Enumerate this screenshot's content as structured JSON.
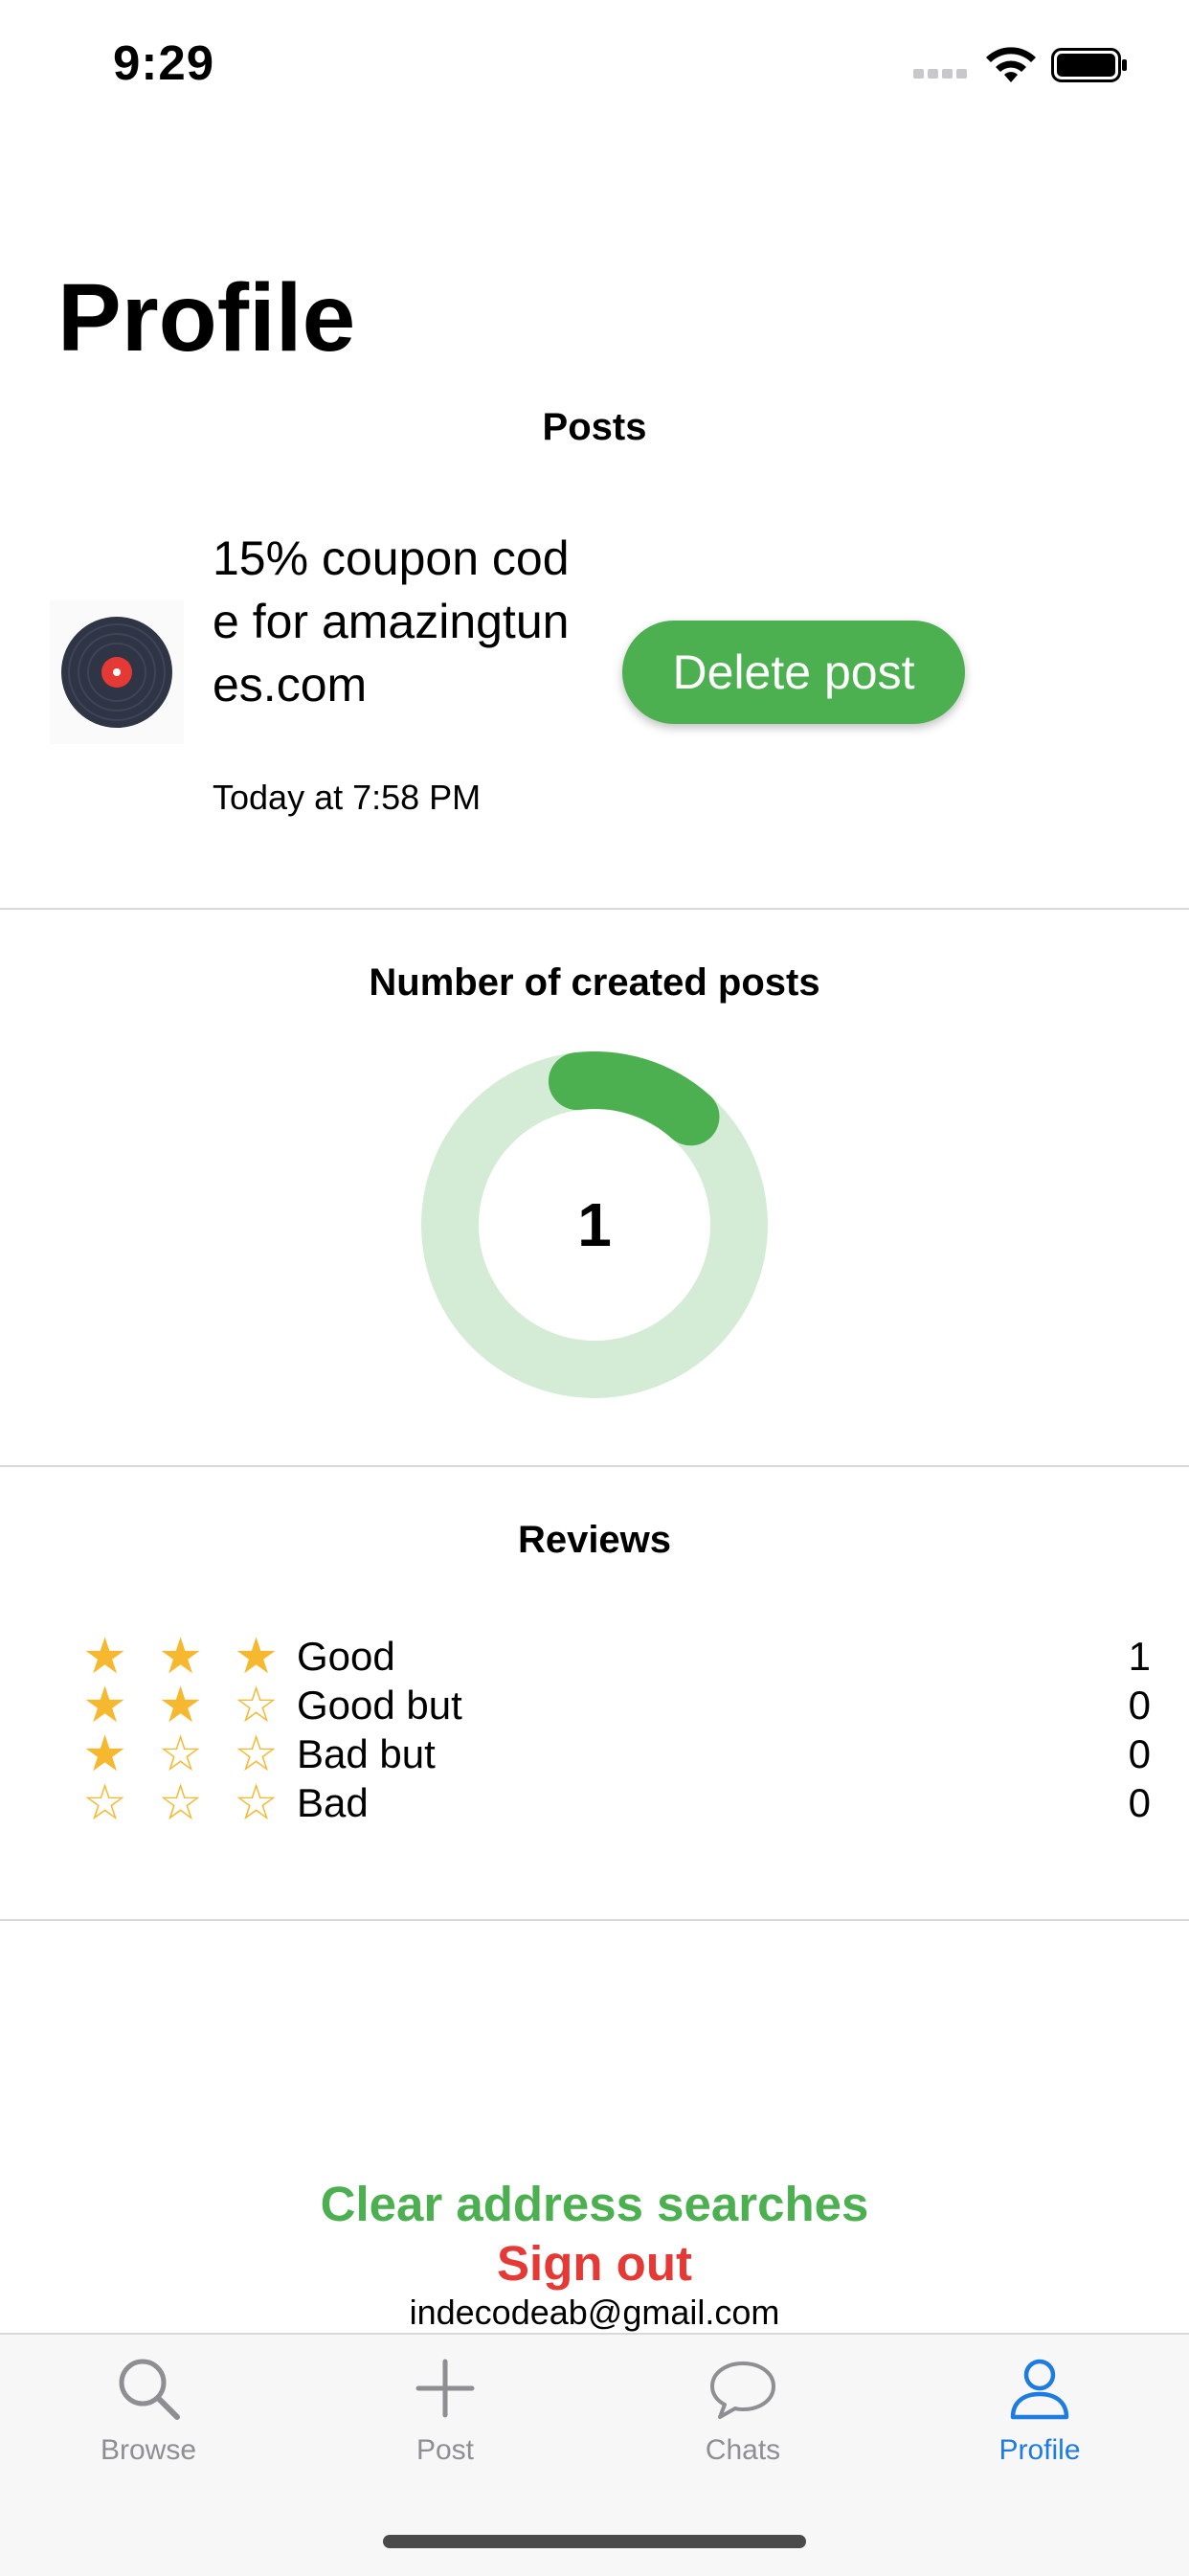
{
  "status_bar": {
    "time": "9:29"
  },
  "header": {
    "title": "Profile"
  },
  "posts": {
    "section_title": "Posts",
    "items": [
      {
        "title": "15% coupon code for amazingtunes.com",
        "time": "Today at 7:58 PM",
        "delete_label": "Delete post",
        "thumbnail_icon": "vinyl-record-icon"
      }
    ]
  },
  "created_posts": {
    "section_title": "Number of created posts",
    "value": "1",
    "progress_fraction": 0.1,
    "colors": {
      "track": "#d4ecd5",
      "fill": "#4caf50"
    }
  },
  "reviews": {
    "section_title": "Reviews",
    "rows": [
      {
        "stars_filled": 3,
        "stars_total": 3,
        "label": "Good",
        "count": "1"
      },
      {
        "stars_filled": 2,
        "stars_total": 3,
        "label": "Good but",
        "count": "0"
      },
      {
        "stars_filled": 1,
        "stars_total": 3,
        "label": "Bad but",
        "count": "0"
      },
      {
        "stars_filled": 0,
        "stars_total": 3,
        "label": "Bad",
        "count": "0"
      }
    ]
  },
  "actions": {
    "clear_searches": "Clear address searches",
    "sign_out": "Sign out",
    "email": "indecodeab@gmail.com"
  },
  "tab_bar": {
    "tabs": [
      {
        "label": "Browse",
        "icon": "search-icon",
        "active": false
      },
      {
        "label": "Post",
        "icon": "plus-icon",
        "active": false
      },
      {
        "label": "Chats",
        "icon": "chat-bubble-icon",
        "active": false
      },
      {
        "label": "Profile",
        "icon": "person-icon",
        "active": true
      }
    ]
  },
  "colors": {
    "accent_green": "#4caf50",
    "danger_red": "#e53935",
    "active_tab": "#1e7be0",
    "star": "#f5b82e"
  }
}
